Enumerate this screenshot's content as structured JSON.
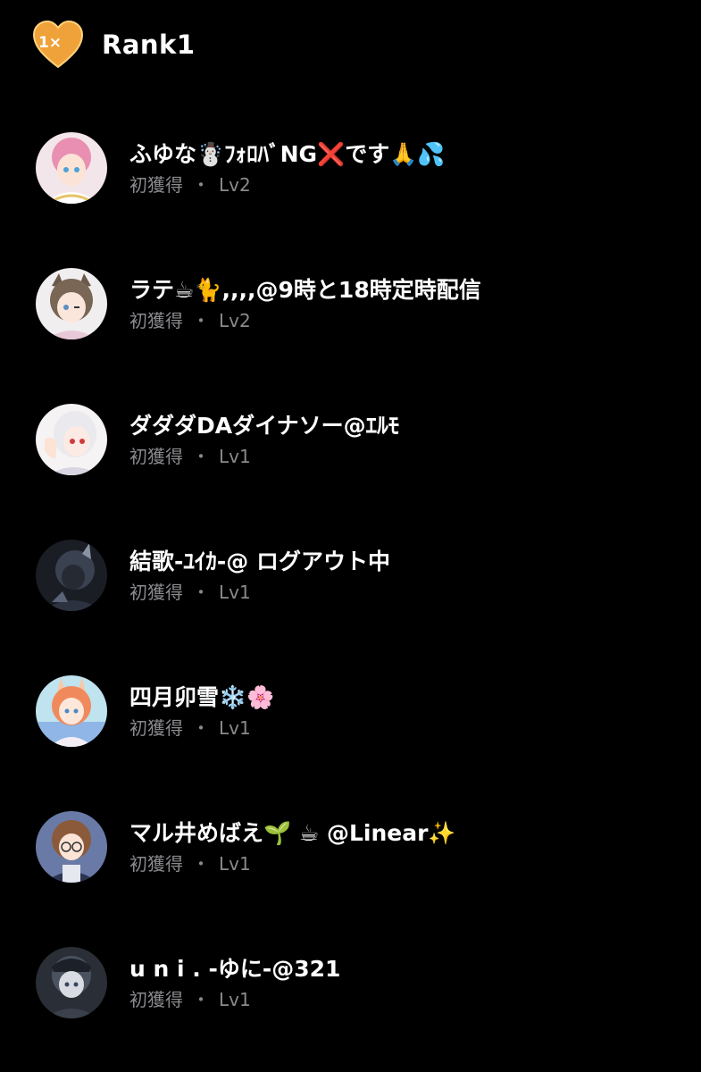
{
  "header": {
    "badge_text": "1×",
    "title": "Rank1"
  },
  "colors": {
    "background": "#000000",
    "badge": "#f0a23a",
    "secondary_text": "#8a8a8e"
  },
  "entries": [
    {
      "name": "ふゆな☃️ﾌｫﾛﾊﾞNG❌です🙏💦",
      "status": "初獲得",
      "level": "Lv2"
    },
    {
      "name": "ラテ☕🐈,,,,@9時と18時定時配信",
      "status": "初獲得",
      "level": "Lv2"
    },
    {
      "name": "ダダダDAダイナソー@ｴﾙﾓ",
      "status": "初獲得",
      "level": "Lv1"
    },
    {
      "name": "結歌-ﾕｲｶ-@ ログアウト中",
      "status": "初獲得",
      "level": "Lv1"
    },
    {
      "name": "四月卯雪❄️🌸",
      "status": "初獲得",
      "level": "Lv1"
    },
    {
      "name": "マル井めばえ🌱 ☕ @Linear✨",
      "status": "初獲得",
      "level": "Lv1"
    },
    {
      "name": "u n i . -ゆに-@321",
      "status": "初獲得",
      "level": "Lv1"
    }
  ],
  "separator": "・"
}
